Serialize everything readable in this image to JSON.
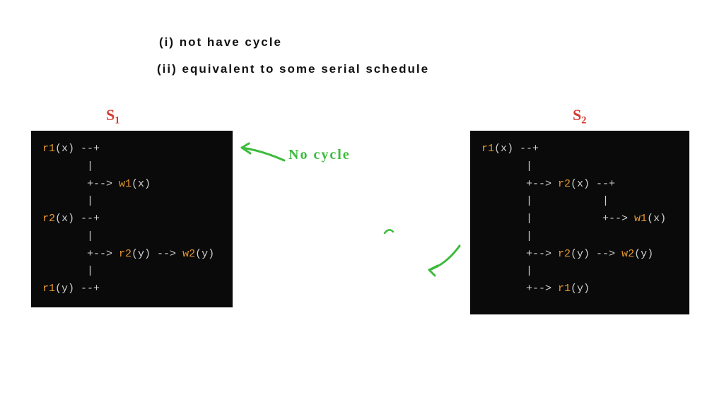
{
  "notes": {
    "line1": "(i) not have cycle",
    "line2": "(ii) equivalent  to  some  serial schedule"
  },
  "labels": {
    "s1_text": "S",
    "s1_sub": "1",
    "s2_text": "S",
    "s2_sub": "2"
  },
  "annotations": {
    "no_cycle": "No cycle"
  },
  "colors": {
    "handwritten": "#111111",
    "red": "#d63a2e",
    "green": "#3dbb3d",
    "code_bg": "#0a0a0a",
    "code_fn": "#e8982f",
    "code_dim": "#cfcfcf"
  },
  "schedules": {
    "s1": {
      "lines": [
        [
          {
            "t": "fn",
            "v": "r1"
          },
          {
            "t": "dim",
            "v": "(x) --+"
          }
        ],
        [
          {
            "t": "dim",
            "v": "       |"
          }
        ],
        [
          {
            "t": "dim",
            "v": "       +--> "
          },
          {
            "t": "fn",
            "v": "w1"
          },
          {
            "t": "dim",
            "v": "(x)"
          }
        ],
        [
          {
            "t": "dim",
            "v": "       |"
          }
        ],
        [
          {
            "t": "fn",
            "v": "r2"
          },
          {
            "t": "dim",
            "v": "(x) --+"
          }
        ],
        [
          {
            "t": "dim",
            "v": "       |"
          }
        ],
        [
          {
            "t": "dim",
            "v": "       +--> "
          },
          {
            "t": "fn",
            "v": "r2"
          },
          {
            "t": "dim",
            "v": "(y) --> "
          },
          {
            "t": "fn",
            "v": "w2"
          },
          {
            "t": "dim",
            "v": "(y)"
          }
        ],
        [
          {
            "t": "dim",
            "v": "       |"
          }
        ],
        [
          {
            "t": "fn",
            "v": "r1"
          },
          {
            "t": "dim",
            "v": "(y) --+"
          }
        ]
      ]
    },
    "s2": {
      "lines": [
        [
          {
            "t": "fn",
            "v": "r1"
          },
          {
            "t": "dim",
            "v": "(x) --+"
          }
        ],
        [
          {
            "t": "dim",
            "v": "       |"
          }
        ],
        [
          {
            "t": "dim",
            "v": "       +--> "
          },
          {
            "t": "fn",
            "v": "r2"
          },
          {
            "t": "dim",
            "v": "(x) --+"
          }
        ],
        [
          {
            "t": "dim",
            "v": "       |           |"
          }
        ],
        [
          {
            "t": "dim",
            "v": "       |           +--> "
          },
          {
            "t": "fn",
            "v": "w1"
          },
          {
            "t": "dim",
            "v": "(x)"
          }
        ],
        [
          {
            "t": "dim",
            "v": "       |"
          }
        ],
        [
          {
            "t": "dim",
            "v": "       +--> "
          },
          {
            "t": "fn",
            "v": "r2"
          },
          {
            "t": "dim",
            "v": "(y) --> "
          },
          {
            "t": "fn",
            "v": "w2"
          },
          {
            "t": "dim",
            "v": "(y)"
          }
        ],
        [
          {
            "t": "dim",
            "v": "       |"
          }
        ],
        [
          {
            "t": "dim",
            "v": "       +--> "
          },
          {
            "t": "fn",
            "v": "r1"
          },
          {
            "t": "dim",
            "v": "(y)"
          }
        ]
      ]
    }
  }
}
